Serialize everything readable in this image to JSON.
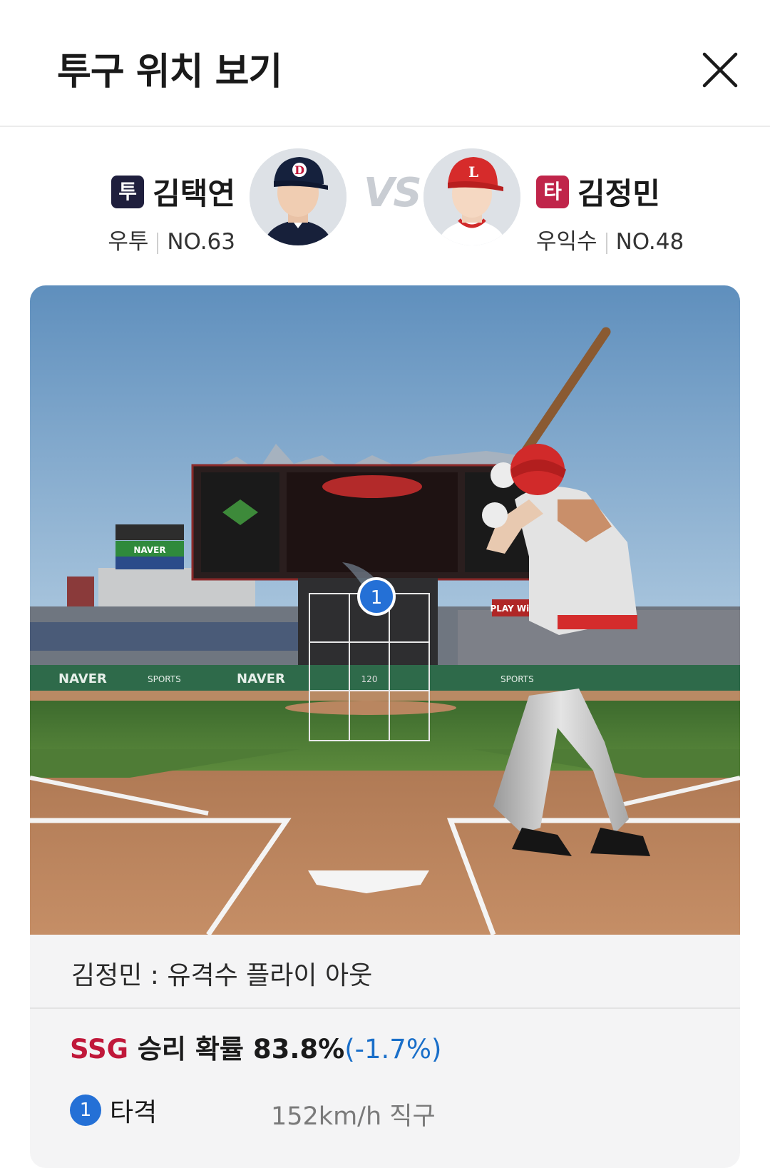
{
  "header": {
    "title": "투구 위치 보기"
  },
  "pitcher": {
    "role": "투",
    "name": "김택연",
    "position": "우투",
    "number": "NO.63",
    "badge_color": "#1f1f3d"
  },
  "vs_label": "VS",
  "batter": {
    "role": "타",
    "name": "김정민",
    "position": "우익수",
    "number": "NO.48",
    "badge_color": "#c0254a"
  },
  "scene": {
    "scoreboard_brand": "NAVER",
    "ad_sports": "SPORTS",
    "banner_text": "PLAY With",
    "strike_zone_label": "120",
    "pitch_marker": "1"
  },
  "result": {
    "text": "김정민 : 유격수 플라이 아웃"
  },
  "win_probability": {
    "team": "SSG",
    "label": " 승리 확률 ",
    "value": "83.8%",
    "delta": "(-1.7%)"
  },
  "pitches": [
    {
      "number": "1",
      "result": "타격",
      "speed": "152km/h",
      "type": "직구"
    }
  ],
  "colors": {
    "team_accent": "#c0183a",
    "delta_blue": "#1a6fc9",
    "pitch_marker": "#2470d6"
  }
}
